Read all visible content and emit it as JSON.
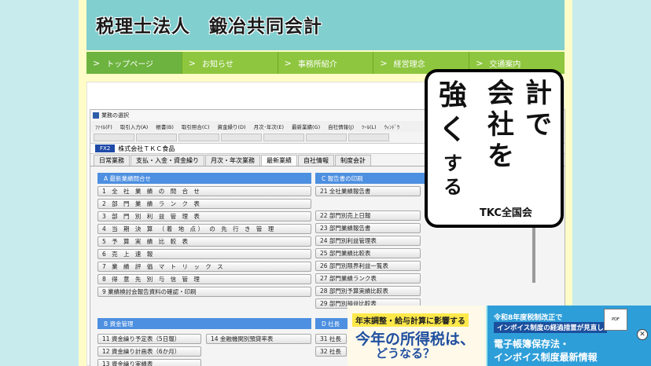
{
  "site": {
    "title": "税理士法人　鍛冶共同会計"
  },
  "nav": [
    {
      "label": "トップページ"
    },
    {
      "label": "お知らせ"
    },
    {
      "label": "事務所紹介"
    },
    {
      "label": "経営理念"
    },
    {
      "label": "交通案内"
    }
  ],
  "app": {
    "window_title": "業務の選択",
    "menu": [
      "ﾌｧｲﾙ(F)",
      "取引入力(A)",
      "帳書(B)",
      "取引照合(C)",
      "資金繰り(D)",
      "月次･年次(E)",
      "最新業績(G)",
      "自社情報(J)",
      "ﾂｰﾙ(L)",
      "ｳｨﾝﾄﾞｳ"
    ],
    "company_code": "FX2",
    "company_name": "株式会社ＴＫＣ食品",
    "tabs": [
      "日常業務",
      "支払・入金・資金繰り",
      "月次・年次業務",
      "最新業績",
      "自社情報",
      "制度会計"
    ],
    "active_tab": "最新業績",
    "section_a": {
      "header": "A  最新業績問合せ",
      "items": [
        "1 全 社 業 績 の 問 合 せ",
        "2 部 門 業 績 ラ ン ク 表",
        "3 部 門 別 利 益 管 理 表",
        "4 当 期 決 算 （着 地 点） の 先 行 き 管 理",
        "5 予 算 実 績 比 較 表",
        "6 売 上 速 報",
        "7 業 績 評 価 マ ト リ ッ ク ス",
        "8 得 意 先 別 与 信 管 理",
        "9 業績検討会報告資料の確認・印刷"
      ]
    },
    "section_b": {
      "header": "B  資金管理",
      "items": [
        "11 資金繰り予定表（5日報）",
        "12 資金繰り計画表（6か月）",
        "13 資金繰り実績表"
      ],
      "extra": "14 金融機関別預貸率表"
    },
    "section_c": {
      "header": "C  報告書の印刷",
      "items": [
        "21 全社業績報告書",
        "22 部門別売上日報",
        "23 部門業績報告書",
        "24 部門別利益管理表",
        "25 部門業績比較表",
        "26 部門別限界利益一覧表",
        "27 部門業績ランク表",
        "28 部門別予算実績比較表",
        "29 部門別損益比較表"
      ]
    },
    "section_d": {
      "header": "D  社長",
      "items": [
        "31 社長",
        "32 社長"
      ]
    }
  },
  "ad": {
    "chars": [
      "会",
      "社",
      "を",
      "計",
      "で",
      "強",
      "く",
      "す",
      "る"
    ],
    "brand": "TKC全国会"
  },
  "banner": {
    "top": "年末調整・給与計算に影響する",
    "headline": "今年の所得税は、",
    "sub": "どうなる？",
    "r1": "令和8年度税制改正で",
    "r2": "インボイス制度の経過措置が見直し",
    "r3": "電子帳簿保存法・",
    "r4": "インボイス制度最新情報",
    "doc": "PDF",
    "close": "✕"
  }
}
